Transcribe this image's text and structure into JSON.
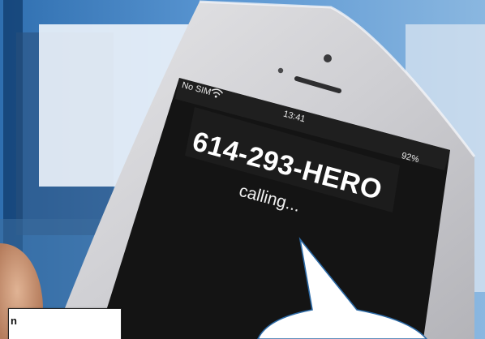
{
  "phone": {
    "carrier": "No SIM",
    "time": "13:41",
    "battery": "92%",
    "caller": "614-293-HERO",
    "call_status": "calling..."
  },
  "caption": {
    "text": "n"
  },
  "colors": {
    "screen": "#141414",
    "phone_body": "#cfcfd2",
    "backdrop": "#4a89c8",
    "bubble_fill": "#ffffff",
    "bubble_stroke": "#2c6aa6"
  }
}
